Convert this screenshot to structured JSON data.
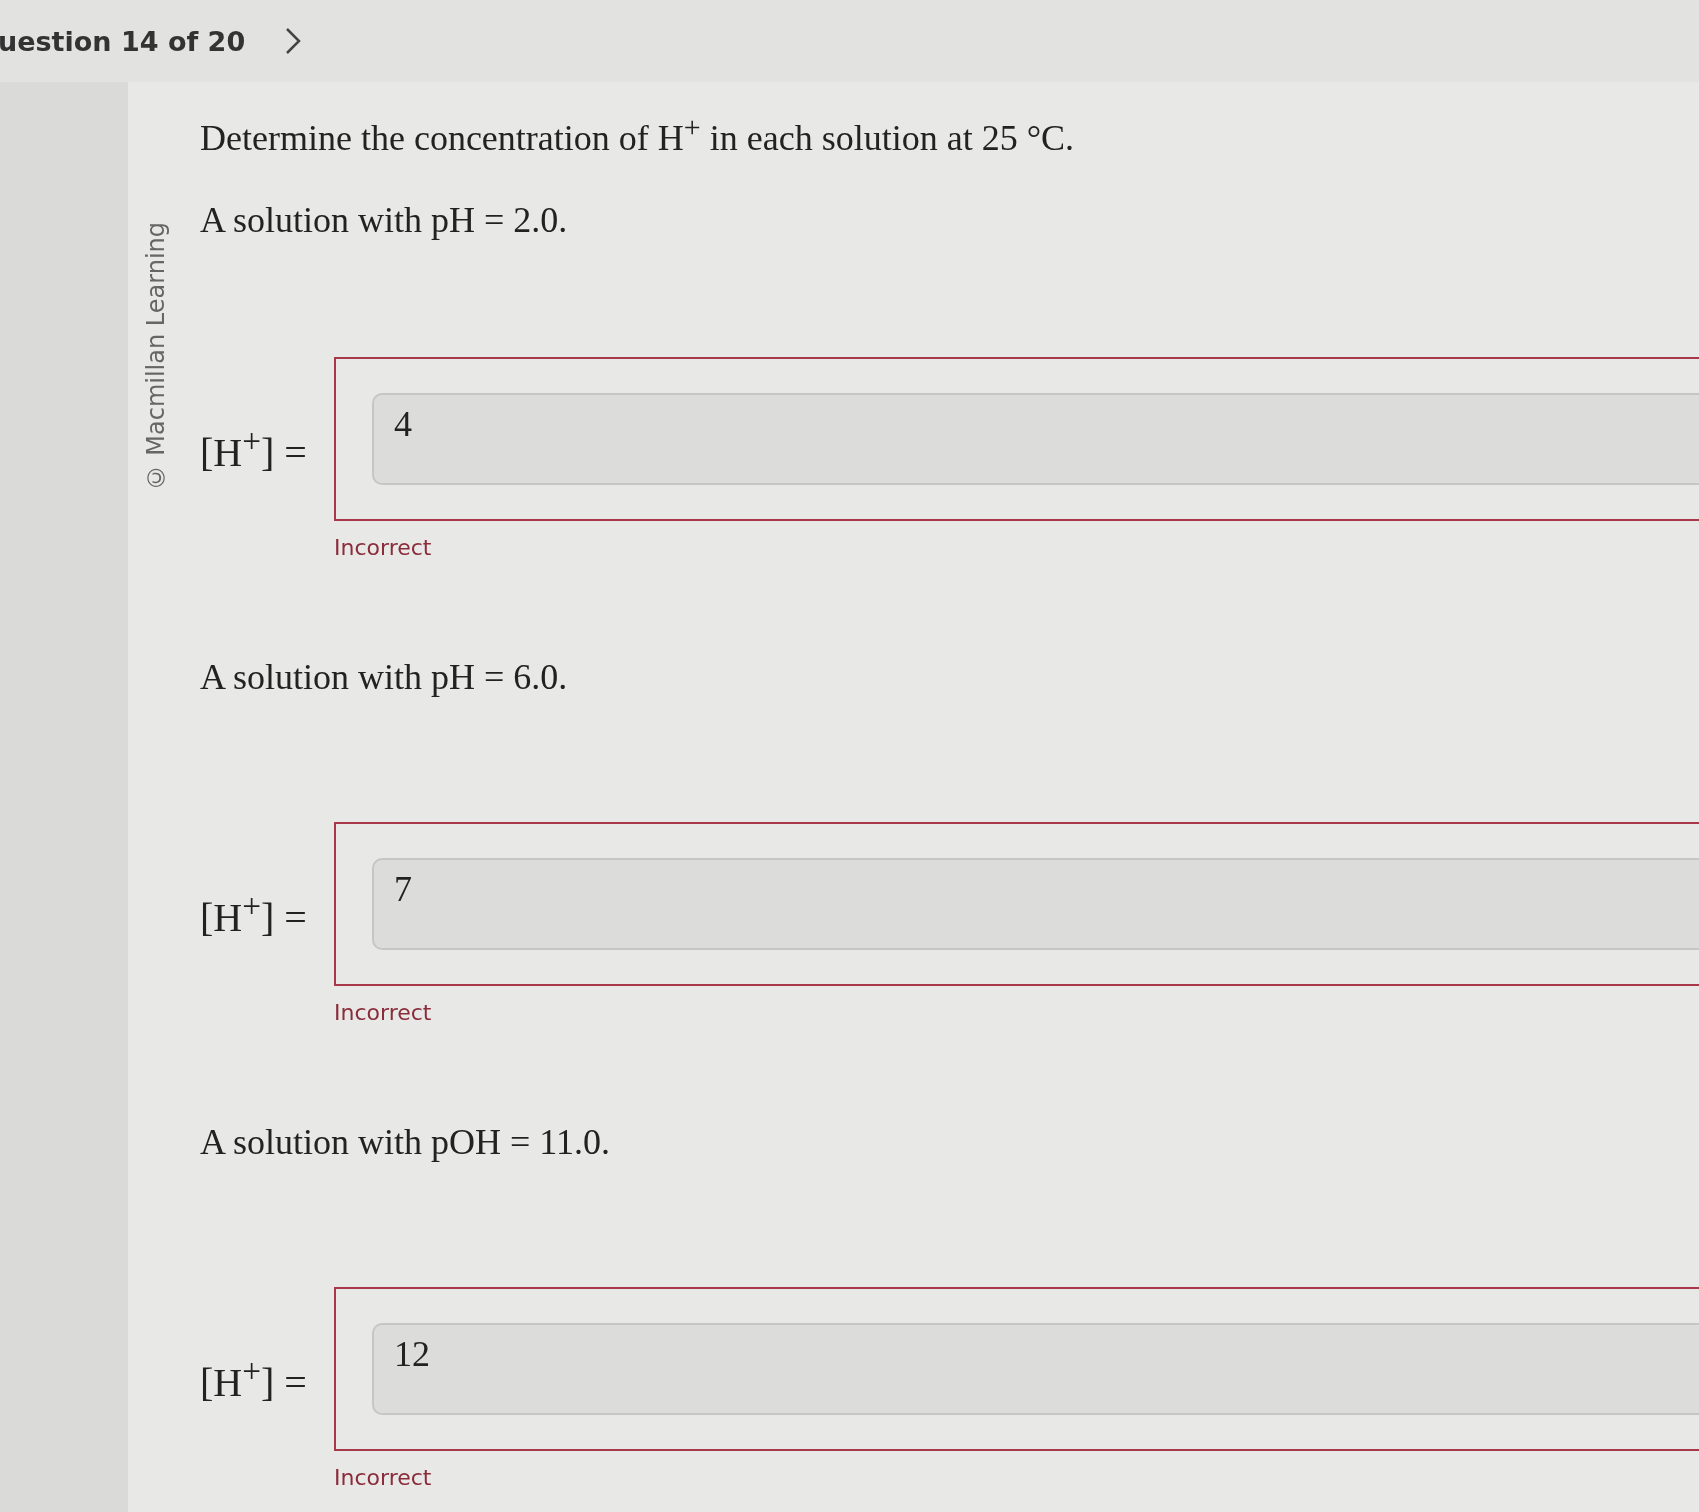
{
  "header": {
    "question_label": "uestion 14 of 20"
  },
  "copyright": "© Macmillan Learning",
  "prompt": "Determine the concentration of H$^{+}$ in each solution at 25 °C.",
  "parts": [
    {
      "prompt": "A solution with pH = 2.0.",
      "label": "[H$^{+}$] =",
      "value": "4",
      "correct": false,
      "feedback": "Incorrect"
    },
    {
      "prompt": "A solution with pH = 6.0.",
      "label": "[H$^{+}$] =",
      "value": "7",
      "correct": false,
      "feedback": "Incorrect"
    },
    {
      "prompt": "A solution with pOH = 11.0.",
      "label": "[H$^{+}$] =",
      "value": "12",
      "correct": false,
      "feedback": "Incorrect"
    }
  ]
}
